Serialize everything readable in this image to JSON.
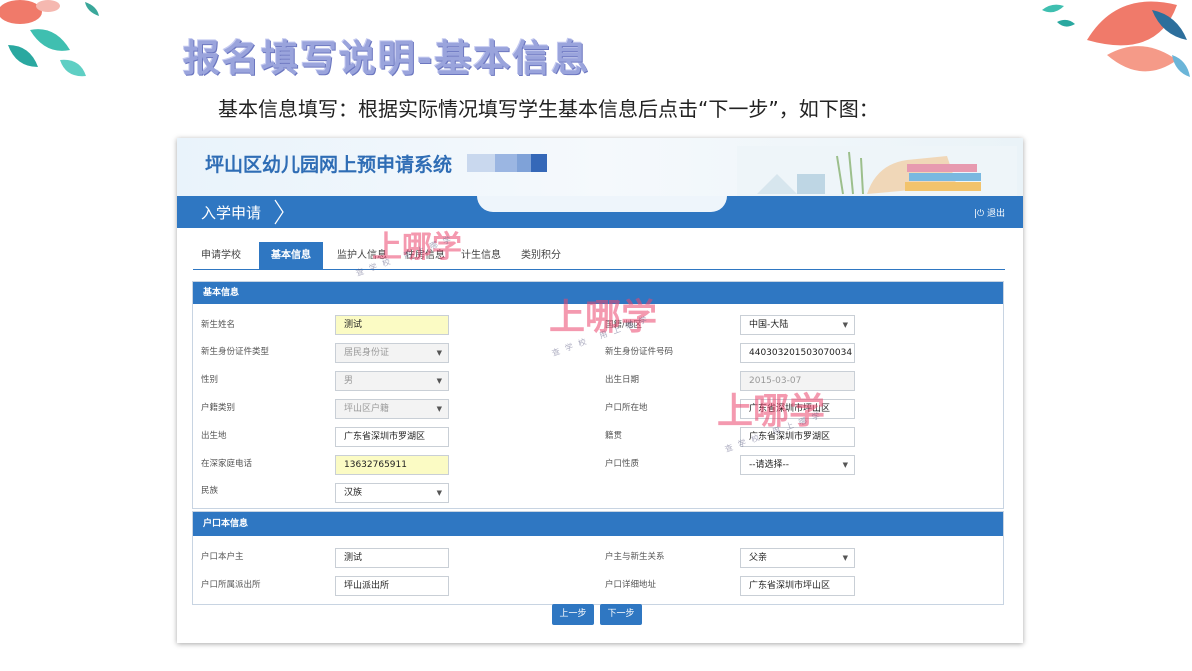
{
  "slide": {
    "title": "报名填写说明-基本信息",
    "instruction": "基本信息填写：根据实际情况填写学生基本信息后点击“下一步”，如下图："
  },
  "app": {
    "system_title": "坪山区幼儿园网上预申请系统",
    "nav_title": "入学申请",
    "logout": "退出"
  },
  "tabs": [
    {
      "label": "申请学校",
      "active": false
    },
    {
      "label": "基本信息",
      "active": true
    },
    {
      "label": "监护人信息",
      "active": false
    },
    {
      "label": "住房信息",
      "active": false
    },
    {
      "label": "计生信息",
      "active": false
    },
    {
      "label": "类别积分",
      "active": false
    }
  ],
  "basic_section": {
    "heading": "基本信息",
    "fields": {
      "name": {
        "label": "新生姓名",
        "value": "测试"
      },
      "id_type": {
        "label": "新生身份证件类型",
        "value": "居民身份证"
      },
      "gender": {
        "label": "性别",
        "value": "男"
      },
      "hukou_type": {
        "label": "户籍类别",
        "value": "坪山区户籍"
      },
      "birthplace": {
        "label": "出生地",
        "value": "广东省深圳市罗湖区"
      },
      "phone": {
        "label": "在深家庭电话",
        "value": "13632765911"
      },
      "ethnicity": {
        "label": "民族",
        "value": "汉族"
      },
      "region": {
        "label": "国籍/地区",
        "value": "中国-大陆"
      },
      "id_number": {
        "label": "新生身份证件号码",
        "value": "440303201503070034"
      },
      "birth_date": {
        "label": "出生日期",
        "value": "2015-03-07"
      },
      "hukou_location": {
        "label": "户口所在地",
        "value": "广东省深圳市坪山区"
      },
      "native_place": {
        "label": "籍贯",
        "value": "广东省深圳市罗湖区"
      },
      "hukou_nature": {
        "label": "户口性质",
        "value": "--请选择--"
      }
    }
  },
  "hukou_section": {
    "heading": "户口本信息",
    "fields": {
      "householder": {
        "label": "户口本户主",
        "value": "测试"
      },
      "police_station": {
        "label": "户口所属派出所",
        "value": "坪山派出所"
      },
      "relation": {
        "label": "户主与新生关系",
        "value": "父亲"
      },
      "address": {
        "label": "户口详细地址",
        "value": "广东省深圳市坪山区"
      }
    }
  },
  "buttons": {
    "prev": "上一步",
    "next": "下一步"
  },
  "watermark": {
    "main": "上哪学",
    "sub": "查学校 用上哪学"
  },
  "colors": {
    "primary": "#2f77c2",
    "highlight_field": "#fbfbc4",
    "title": "#9aa4dc"
  }
}
